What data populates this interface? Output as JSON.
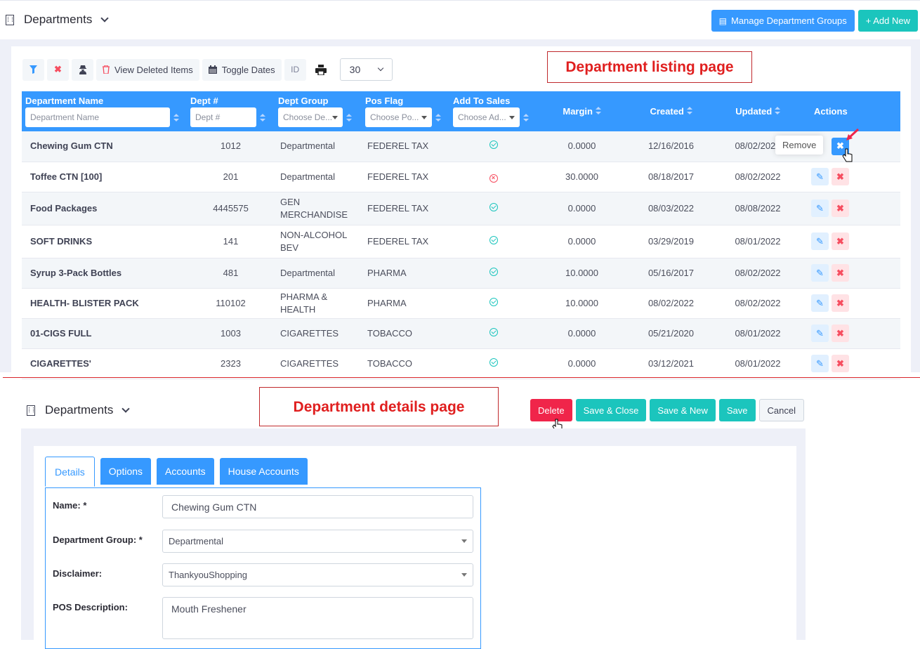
{
  "top": {
    "title": "Departments",
    "buttons": {
      "manage_groups": "Manage Department Groups",
      "add_new": "+ Add New"
    },
    "toolbar": {
      "view_deleted": "View Deleted Items",
      "toggle_dates": "Toggle Dates",
      "id": "ID",
      "page_size": "30"
    },
    "annotation": "Department listing page",
    "columns": {
      "name": "Department Name",
      "dept": "Dept #",
      "group": "Dept Group",
      "pos": "Pos Flag",
      "sales": "Add To Sales",
      "margin": "Margin",
      "created": "Created",
      "updated": "Updated",
      "actions": "Actions"
    },
    "filters": {
      "name": "Department Name",
      "dept": "Dept #",
      "group": "Choose De...",
      "pos": "Choose Po...",
      "sales": "Choose Ad..."
    },
    "rows": [
      {
        "name": "Chewing Gum CTN",
        "dept": "1012",
        "group": "Departmental",
        "pos": "FEDEREL TAX",
        "sales": "yes",
        "margin": "0.0000",
        "created": "12/16/2016",
        "updated": "08/02/2022"
      },
      {
        "name": "Toffee CTN [100]",
        "dept": "201",
        "group": "Departmental",
        "pos": "FEDEREL TAX",
        "sales": "no",
        "margin": "30.0000",
        "created": "08/18/2017",
        "updated": "08/02/2022"
      },
      {
        "name": "Food Packages",
        "dept": "4445575",
        "group": "GEN MERCHANDISE",
        "pos": "FEDEREL TAX",
        "sales": "yes",
        "margin": "0.0000",
        "created": "08/03/2022",
        "updated": "08/08/2022"
      },
      {
        "name": "SOFT DRINKS",
        "dept": "141",
        "group": "NON-ALCOHOL BEV",
        "pos": "FEDEREL TAX",
        "sales": "yes",
        "margin": "0.0000",
        "created": "03/29/2019",
        "updated": "08/01/2022"
      },
      {
        "name": "Syrup 3-Pack Bottles",
        "dept": "481",
        "group": "Departmental",
        "pos": "PHARMA",
        "sales": "yes",
        "margin": "10.0000",
        "created": "05/16/2017",
        "updated": "08/02/2022"
      },
      {
        "name": "HEALTH- BLISTER PACK",
        "dept": "110102",
        "group": "PHARMA & HEALTH",
        "pos": "PHARMA",
        "sales": "yes",
        "margin": "10.0000",
        "created": "08/02/2022",
        "updated": "08/02/2022"
      },
      {
        "name": "01-CIGS FULL",
        "dept": "1003",
        "group": "CIGARETTES",
        "pos": "TOBACCO",
        "sales": "yes",
        "margin": "0.0000",
        "created": "05/21/2020",
        "updated": "08/01/2022"
      },
      {
        "name": "CIGARETTES'",
        "dept": "2323",
        "group": "CIGARETTES",
        "pos": "TOBACCO",
        "sales": "yes",
        "margin": "0.0000",
        "created": "03/12/2021",
        "updated": "08/01/2022"
      }
    ],
    "tooltip": "Remove"
  },
  "bottom": {
    "title": "Departments",
    "annotation": "Department details page",
    "buttons": {
      "delete": "Delete",
      "save_close": "Save & Close",
      "save_new": "Save & New",
      "save": "Save",
      "cancel": "Cancel"
    },
    "tabs": [
      "Details",
      "Options",
      "Accounts",
      "House Accounts"
    ],
    "form": {
      "name_label": "Name: *",
      "name_value": "Chewing Gum CTN",
      "group_label": "Department Group: *",
      "group_value": "Departmental",
      "disclaimer_label": "Disclaimer:",
      "disclaimer_value": "ThankyouShopping",
      "pos_label": "POS Description:",
      "pos_value": "Mouth Freshener"
    }
  },
  "colors": {
    "primary": "#3699ff",
    "teal": "#1bc5bd",
    "danger": "#f0254a",
    "annotation_red": "#e01f1f"
  }
}
